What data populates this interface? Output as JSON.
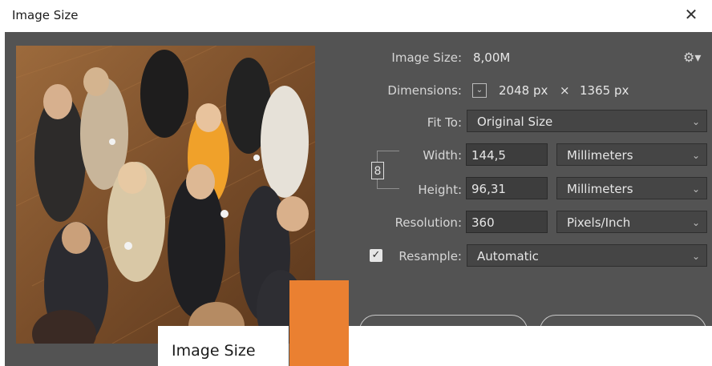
{
  "window": {
    "title": "Image Size"
  },
  "rows": {
    "image_size": {
      "label": "Image Size:",
      "value": "8,00M"
    },
    "dimensions": {
      "label": "Dimensions:",
      "width": "2048 px",
      "times": "×",
      "height": "1365 px"
    },
    "fit_to": {
      "label": "Fit To:",
      "value": "Original Size"
    },
    "width": {
      "label": "Width:",
      "value": "144,5",
      "unit": "Millimeters"
    },
    "height": {
      "label": "Height:",
      "value": "96,31",
      "unit": "Millimeters"
    },
    "resolution": {
      "label": "Resolution:",
      "value": "360",
      "unit": "Pixels/Inch"
    },
    "resample": {
      "label": "Resample:",
      "value": "Automatic",
      "checked": true
    }
  },
  "tooltip": {
    "text": "Image Size"
  },
  "colors": {
    "panel": "#535353",
    "orange": "#ea8031"
  },
  "icons": [
    "close-icon",
    "gear-icon",
    "chevron-down-icon",
    "link-icon",
    "check-icon"
  ]
}
